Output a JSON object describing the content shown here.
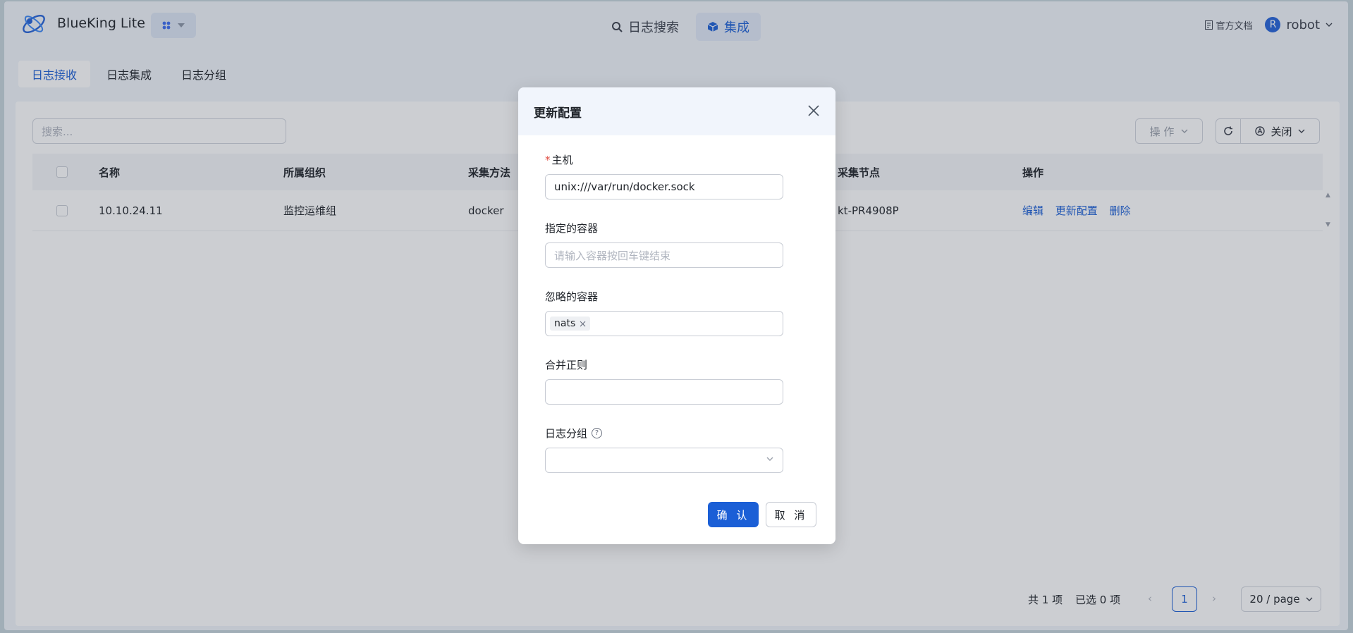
{
  "app": {
    "brand": "BlueKing Lite"
  },
  "nav": {
    "items": [
      {
        "label": "日志搜索",
        "icon": "search-icon"
      },
      {
        "label": "集成",
        "icon": "cube-icon"
      }
    ]
  },
  "topright": {
    "docs": "官方文档",
    "avatar_letter": "R",
    "user": "robot"
  },
  "tabs": [
    "日志接收",
    "日志集成",
    "日志分组"
  ],
  "toolbar": {
    "search_placeholder": "搜索...",
    "op_label": "操 作",
    "auto_label": "关闭"
  },
  "table": {
    "headers": [
      "名称",
      "所属组织",
      "采集方法",
      "采集节点",
      "操作"
    ],
    "rows": [
      {
        "name": "10.10.24.11",
        "org": "监控运维组",
        "method": "docker",
        "node": "kt-PR4908P",
        "actions": [
          "编辑",
          "更新配置",
          "删除"
        ]
      }
    ]
  },
  "footer": {
    "total": "共 1 项",
    "selected": "已选 0 项",
    "page": "1",
    "page_size": "20 / page"
  },
  "modal": {
    "title": "更新配置",
    "fields": {
      "host": {
        "label": "主机",
        "value": "unix:///var/run/docker.sock"
      },
      "containers": {
        "label": "指定的容器",
        "placeholder": "请输入容器按回车键结束"
      },
      "ignored": {
        "label": "忽略的容器",
        "tags": [
          "nats"
        ]
      },
      "merge": {
        "label": "合并正则",
        "value": ""
      },
      "group": {
        "label": "日志分组",
        "value": ""
      }
    },
    "ok": "确 认",
    "cancel": "取 消"
  },
  "colors": {
    "accent": "#1b5fd6",
    "required": "#e04a3f"
  }
}
